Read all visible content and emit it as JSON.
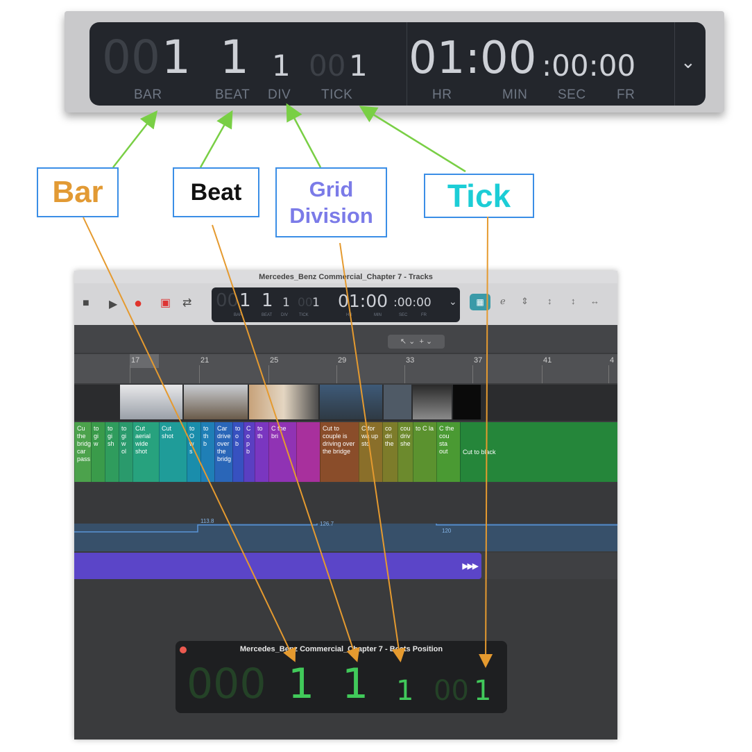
{
  "zoom_lcd": {
    "bar_dim": "00",
    "bar": "1",
    "beat": "1",
    "div": "1",
    "tick_dim": "00",
    "tick": "1",
    "time_main": "01:00",
    "time_sec": ":00:00",
    "labels": {
      "bar": "BAR",
      "beat": "BEAT",
      "div": "DIV",
      "tick": "TICK",
      "hr": "HR",
      "min": "MIN",
      "sec": "SEC",
      "fr": "FR"
    },
    "chevron": "chevron-down-icon"
  },
  "annotations": {
    "bar": {
      "text": "Bar",
      "color": "#e29a34"
    },
    "beat": {
      "text": "Beat",
      "color": "#111111"
    },
    "grid_division": {
      "line1": "Grid",
      "line2": "Division",
      "color": "#7b7be8"
    },
    "tick": {
      "text": "Tick",
      "color": "#1ccdd6"
    },
    "arrow_green": "#79cf45",
    "arrow_orange": "#e59a2f"
  },
  "window": {
    "title": "Mercedes_Benz Commercial_Chapter 7 - Tracks",
    "lcd": {
      "bar_dim": "00",
      "bar": "1",
      "beat": "1",
      "div": "1",
      "tick_dim": "00",
      "tick": "1",
      "time_main": "01:00",
      "time_sec": ":00:00",
      "labels": {
        "bar": "BAR",
        "beat": "BEAT",
        "div": "DIV",
        "tick": "TICK",
        "hr": "HR",
        "min": "MIN",
        "sec": "SEC",
        "fr": "FR"
      }
    },
    "ruler": [
      "17",
      "21",
      "25",
      "29",
      "33",
      "37",
      "41",
      "4"
    ],
    "markers": [
      {
        "text": "Cu the bridg car pass",
        "color": "#4ca24c"
      },
      {
        "text": "to gi w",
        "color": "#3a9b4a"
      },
      {
        "text": "to gi sh",
        "color": "#2f9c5d"
      },
      {
        "text": "to gi w ol",
        "color": "#2a9a6c"
      },
      {
        "text": "Cut aerial wide shot",
        "color": "#27a27e"
      },
      {
        "text": "Cut shot",
        "color": "#1f9c99"
      },
      {
        "text": "to O w s",
        "color": "#1a8dab"
      },
      {
        "text": "to th b",
        "color": "#1f7fb6"
      },
      {
        "text": "Car drive over the bridg",
        "color": "#2a66b8"
      },
      {
        "text": "to o b",
        "color": "#3751c0"
      },
      {
        "text": "C o p b",
        "color": "#5a3fc2"
      },
      {
        "text": "to th",
        "color": "#7a36c0"
      },
      {
        "text": "C the bri",
        "color": "#9033b4"
      },
      {
        "text": "",
        "color": "#a8309d"
      },
      {
        "text": "Cut to couple is driving over the bridge",
        "color": "#8a4d2a"
      },
      {
        "text": "C for wa up sto",
        "color": "#8a6f2a"
      },
      {
        "text": "co dri the",
        "color": "#7d7c2a"
      },
      {
        "text": "cou driv she",
        "color": "#6c8a2d"
      },
      {
        "text": "to C la",
        "color": "#5b922f"
      },
      {
        "text": "C the cou sta out",
        "color": "#4a9a33"
      },
      {
        "text": "Cut to black",
        "color": "#25863a"
      }
    ],
    "tempo": [
      "113.8",
      "126.7",
      "120"
    ]
  },
  "beats_position": {
    "title": "Mercedes_Benz Commercial_Chapter 7 - Beats Position",
    "bar_dim": "000",
    "bar": "1",
    "beat": "1",
    "div": "1",
    "tick_dim": "00",
    "tick": "1"
  }
}
